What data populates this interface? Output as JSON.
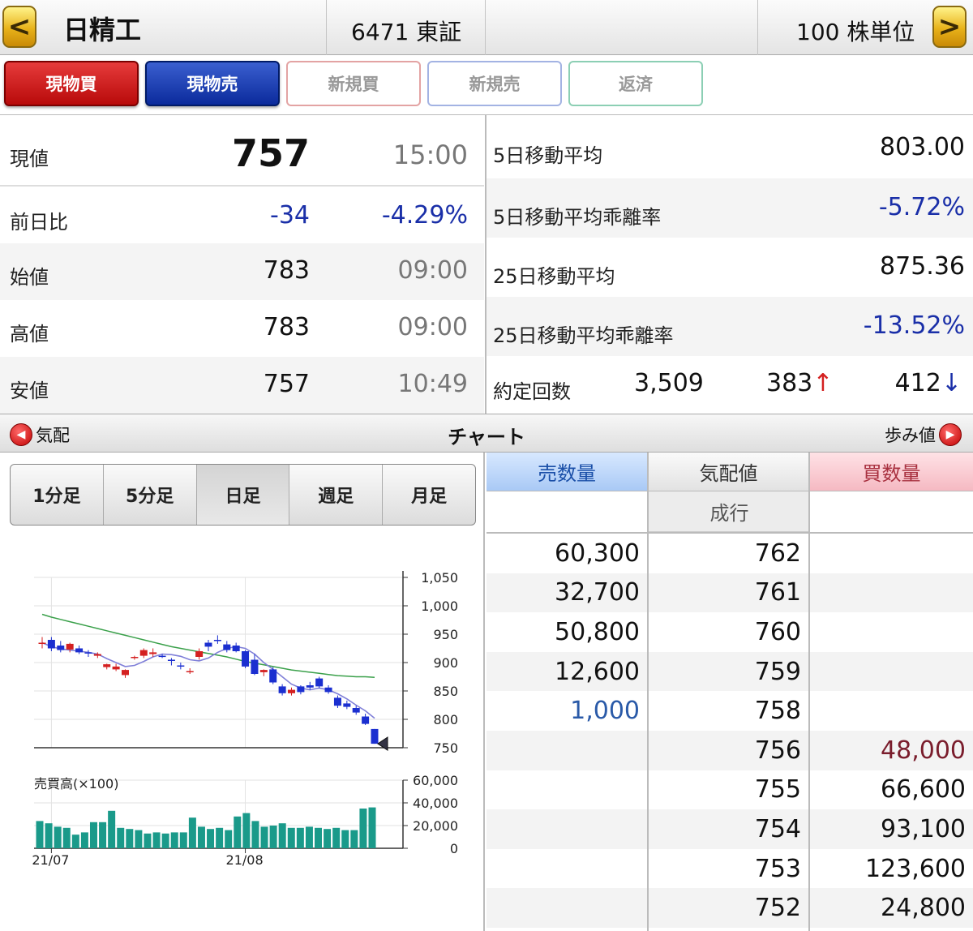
{
  "header": {
    "back_icon": "chevron-left-icon",
    "name": "日精工",
    "code": "6471 東証",
    "blank": "",
    "unit": "100 株単位",
    "next_icon": "chevron-right-icon"
  },
  "tabs": [
    "現物買",
    "現物売",
    "新規買",
    "新規売",
    "返済"
  ],
  "quote": {
    "current": {
      "label": "現値",
      "value": "757",
      "time": "15:00"
    },
    "change": {
      "label": "前日比",
      "value": "-34",
      "pct": "-4.29%"
    },
    "open": {
      "label": "始値",
      "value": "783",
      "time": "09:00"
    },
    "high": {
      "label": "高値",
      "value": "783",
      "time": "09:00"
    },
    "low": {
      "label": "安値",
      "value": "757",
      "time": "10:49"
    }
  },
  "stats": {
    "ma5": {
      "label": "5日移動平均",
      "value": "803.00"
    },
    "ma5_dev": {
      "label": "5日移動平均乖離率",
      "value": "-5.72%"
    },
    "ma25": {
      "label": "25日移動平均",
      "value": "875.36"
    },
    "ma25_dev": {
      "label": "25日移動平均乖離率",
      "value": "-13.52%"
    },
    "trades": {
      "label": "約定回数",
      "total": "3,509",
      "up": "383",
      "up_arrow": "↑",
      "down": "412",
      "down_arrow": "↓"
    }
  },
  "section": {
    "left": "気配",
    "center": "チャート",
    "right": "歩み値"
  },
  "periods": [
    "1分足",
    "5分足",
    "日足",
    "週足",
    "月足"
  ],
  "selected_period": "日足",
  "chart_data": {
    "type": "candlestick",
    "price_axis": {
      "ticks": [
        "1,050",
        "1,000",
        "950",
        "900",
        "850",
        "800",
        "750"
      ],
      "range": [
        750,
        1050
      ]
    },
    "volume_axis": {
      "title": "売買高(×100)",
      "ticks": [
        "60,000",
        "40,000",
        "20,000",
        "0"
      ],
      "range": [
        0,
        60000
      ]
    },
    "x_ticks": [
      "21/07",
      "21/08"
    ],
    "colors": {
      "up": "#d42020",
      "down": "#1b2fd0",
      "ma5": "#7f7fd8",
      "ma25": "#3aa04a",
      "volume": "#1a9a8a"
    },
    "candles": [
      {
        "o": 935,
        "h": 945,
        "l": 925,
        "c": 935
      },
      {
        "o": 940,
        "h": 945,
        "l": 920,
        "c": 925
      },
      {
        "o": 930,
        "h": 938,
        "l": 918,
        "c": 922
      },
      {
        "o": 923,
        "h": 935,
        "l": 918,
        "c": 933
      },
      {
        "o": 925,
        "h": 930,
        "l": 915,
        "c": 918
      },
      {
        "o": 918,
        "h": 922,
        "l": 910,
        "c": 916
      },
      {
        "o": 912,
        "h": 918,
        "l": 908,
        "c": 915
      },
      {
        "o": 892,
        "h": 898,
        "l": 888,
        "c": 897
      },
      {
        "o": 888,
        "h": 898,
        "l": 885,
        "c": 893
      },
      {
        "o": 878,
        "h": 888,
        "l": 873,
        "c": 887
      },
      {
        "o": 908,
        "h": 912,
        "l": 905,
        "c": 910
      },
      {
        "o": 912,
        "h": 925,
        "l": 908,
        "c": 922
      },
      {
        "o": 915,
        "h": 925,
        "l": 910,
        "c": 918
      },
      {
        "o": 912,
        "h": 915,
        "l": 908,
        "c": 910
      },
      {
        "o": 905,
        "h": 908,
        "l": 895,
        "c": 903
      },
      {
        "o": 895,
        "h": 900,
        "l": 888,
        "c": 893
      },
      {
        "o": 885,
        "h": 890,
        "l": 880,
        "c": 885
      },
      {
        "o": 910,
        "h": 925,
        "l": 905,
        "c": 920
      },
      {
        "o": 935,
        "h": 940,
        "l": 920,
        "c": 928
      },
      {
        "o": 940,
        "h": 948,
        "l": 933,
        "c": 938
      },
      {
        "o": 932,
        "h": 938,
        "l": 918,
        "c": 922
      },
      {
        "o": 930,
        "h": 935,
        "l": 918,
        "c": 920
      },
      {
        "o": 920,
        "h": 922,
        "l": 890,
        "c": 893
      },
      {
        "o": 905,
        "h": 915,
        "l": 878,
        "c": 880
      },
      {
        "o": 883,
        "h": 888,
        "l": 876,
        "c": 887
      },
      {
        "o": 888,
        "h": 892,
        "l": 862,
        "c": 865
      },
      {
        "o": 858,
        "h": 862,
        "l": 842,
        "c": 846
      },
      {
        "o": 846,
        "h": 856,
        "l": 842,
        "c": 852
      },
      {
        "o": 858,
        "h": 860,
        "l": 844,
        "c": 848
      },
      {
        "o": 860,
        "h": 866,
        "l": 852,
        "c": 856
      },
      {
        "o": 872,
        "h": 875,
        "l": 855,
        "c": 858
      },
      {
        "o": 856,
        "h": 860,
        "l": 845,
        "c": 848
      },
      {
        "o": 838,
        "h": 842,
        "l": 820,
        "c": 824
      },
      {
        "o": 828,
        "h": 833,
        "l": 818,
        "c": 822
      },
      {
        "o": 820,
        "h": 824,
        "l": 808,
        "c": 812
      },
      {
        "o": 805,
        "h": 810,
        "l": 790,
        "c": 792
      },
      {
        "o": 783,
        "h": 783,
        "l": 757,
        "c": 757
      }
    ],
    "ma5": [
      935,
      928,
      924,
      922,
      920,
      918,
      915,
      907,
      900,
      893,
      895,
      902,
      910,
      915,
      914,
      911,
      905,
      903,
      908,
      918,
      925,
      928,
      925,
      915,
      900,
      888,
      875,
      862,
      855,
      852,
      855,
      852,
      845,
      836,
      825,
      815,
      802
    ],
    "ma25": [
      985,
      980,
      976,
      972,
      968,
      964,
      960,
      956,
      952,
      948,
      944,
      940,
      936,
      932,
      928,
      925,
      922,
      919,
      916,
      913,
      910,
      906,
      902,
      899,
      896,
      893,
      890,
      887,
      885,
      883,
      881,
      879,
      877,
      876,
      875,
      875,
      874
    ],
    "volume": [
      24000,
      22000,
      19000,
      18000,
      12000,
      14000,
      23000,
      23000,
      33000,
      18000,
      17000,
      16000,
      13000,
      14000,
      13000,
      14000,
      14000,
      27000,
      19000,
      17000,
      18000,
      16000,
      28000,
      31000,
      24000,
      19000,
      20000,
      22000,
      18000,
      18000,
      19000,
      18000,
      17000,
      18000,
      16000,
      16000,
      35000,
      36000
    ]
  },
  "book": {
    "headers": {
      "sell": "売数量",
      "price": "気配値",
      "buy": "買数量"
    },
    "market": "成行",
    "rows": [
      {
        "sell": "60,300",
        "price": "762",
        "buy": ""
      },
      {
        "sell": "32,700",
        "price": "761",
        "buy": ""
      },
      {
        "sell": "50,800",
        "price": "760",
        "buy": ""
      },
      {
        "sell": "12,600",
        "price": "759",
        "buy": ""
      },
      {
        "sell": "1,000",
        "price": "758",
        "buy": ""
      },
      {
        "sell": "",
        "price": "756",
        "buy": "48,000"
      },
      {
        "sell": "",
        "price": "755",
        "buy": "66,600"
      },
      {
        "sell": "",
        "price": "754",
        "buy": "93,100"
      },
      {
        "sell": "",
        "price": "753",
        "buy": "123,600"
      },
      {
        "sell": "",
        "price": "752",
        "buy": "24,800"
      }
    ]
  }
}
